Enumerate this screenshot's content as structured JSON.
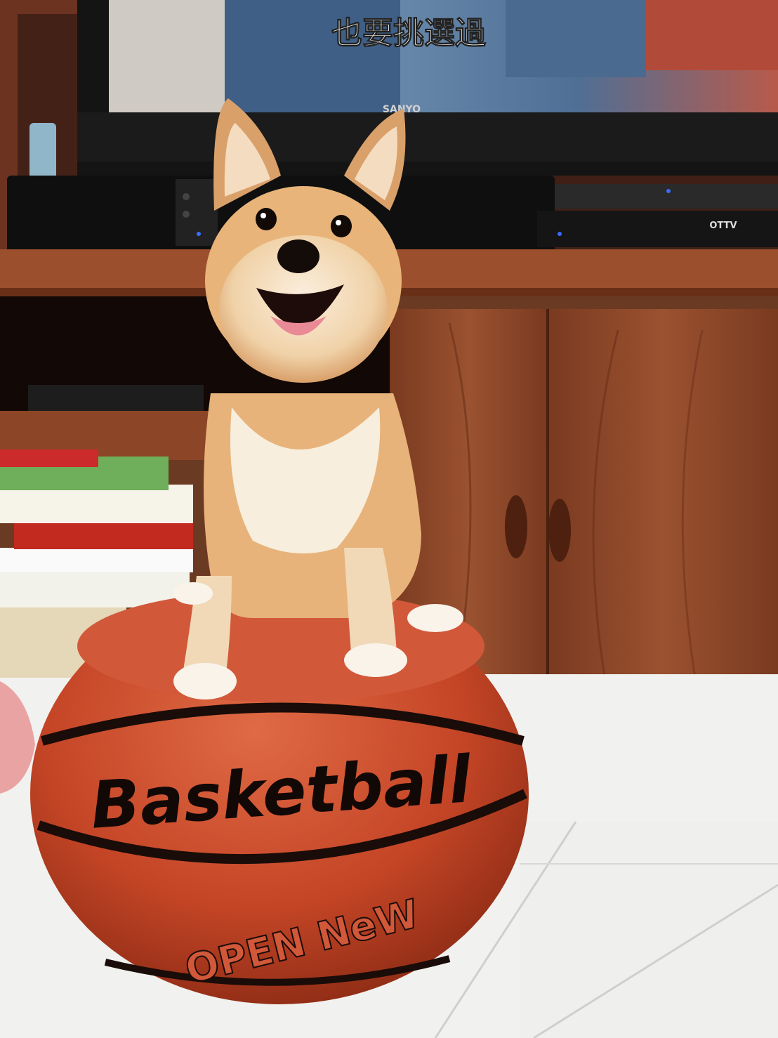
{
  "tv": {
    "brand": "SANYO",
    "subtitle": "也要挑選過"
  },
  "set_top_box": {
    "brand": "OTTV"
  },
  "ball": {
    "word_main": "Basketball",
    "word_sub": "OPEN NeW"
  },
  "colors": {
    "wall": "#4a2417",
    "cabinet": "#8a4426",
    "cabinet_dark": "#5e2a16",
    "ball": "#c9482a",
    "ball_seam": "#2a1410",
    "floor": "#f2f2f0",
    "dog_fur": "#e8b47a",
    "dog_cream": "#f7efe0"
  }
}
